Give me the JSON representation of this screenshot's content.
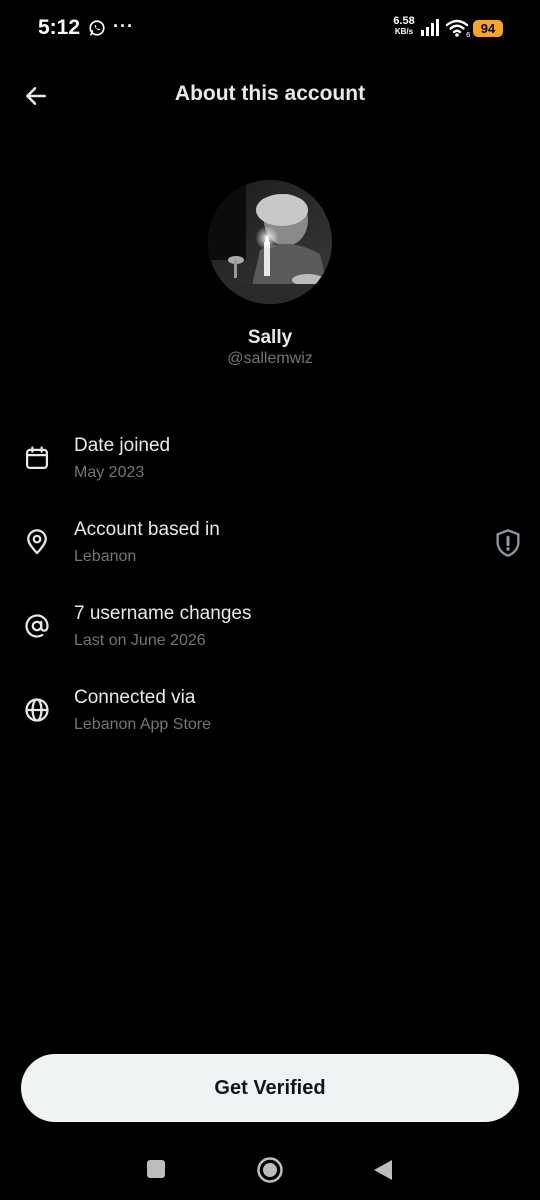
{
  "status_bar": {
    "time": "5:12",
    "more": "···",
    "network_speed": "6.58",
    "network_speed_unit": "KB/s",
    "battery": "94",
    "colors": {
      "battery": "#f5a623"
    }
  },
  "header": {
    "title": "About this account",
    "back_icon": "arrow-left-icon"
  },
  "profile": {
    "name": "Sally",
    "handle": "@sallemwiz"
  },
  "info_items": [
    {
      "icon": "calendar-icon",
      "label": "Date joined",
      "value": "May 2023"
    },
    {
      "icon": "location-pin-icon",
      "label": "Account based in",
      "value": "Lebanon",
      "badge_icon": "shield-alert-icon"
    },
    {
      "icon": "at-sign-icon",
      "label": "7 username changes",
      "value": "Last on June 2026"
    },
    {
      "icon": "globe-icon",
      "label": "Connected via",
      "value": "Lebanon App Store"
    }
  ],
  "cta": {
    "label": "Get Verified"
  },
  "theme": {
    "background": "#000000",
    "primary_text": "#e7e9ea",
    "secondary_text": "#71767b",
    "button_bg": "#eff3f4",
    "button_text": "#0f1419"
  }
}
